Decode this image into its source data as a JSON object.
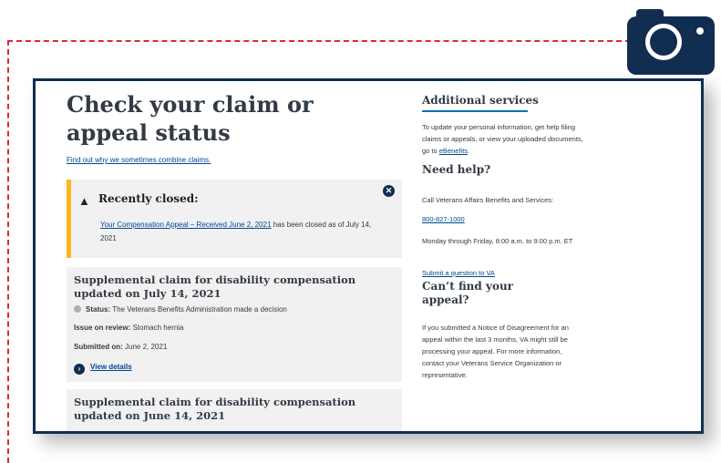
{
  "main": {
    "title": "Check your claim or appeal status",
    "combine_link": "Find out why we sometimes combine claims."
  },
  "alert": {
    "title": "Recently closed:",
    "link_text": "Your Compensation Appeal – Received June 2, 2021",
    "text": " has been closed as of July 14, 2021"
  },
  "claims": [
    {
      "title": "Supplemental claim for disability compensation updated on July 14, 2021",
      "status_label": "Status:",
      "status_text": " The Veterans Benefits Administration made a decision",
      "issue_label": "Issue on review:",
      "issue_value": " Stomach hernia",
      "submitted_label": "Submitted on:",
      "submitted_value": " June 2, 2021",
      "details_link": "View details"
    },
    {
      "title": "Supplemental claim for disability compensation updated on June 14, 2021"
    }
  ],
  "sidebar": {
    "additional_heading": "Additional services",
    "additional_text": "To update your personal information, get help filing claims or appeals, or view your uploaded documents, go to ",
    "ebenefits_link": "eBenefits",
    "period": ".",
    "help_heading": "Need help?",
    "help_call": "Call Veterans Affairs Benefits and Services:",
    "phone": "800-827-1000",
    "hours": "Monday through Friday, 8:00 a.m. to 9:00 p.m. ET",
    "submit_link": "Submit a question to VA",
    "cant_find_heading": "Can’t find your appeal?",
    "cant_find_text": "If you submitted a Notice of Disagreement for an appeal within the last 3 months, VA might still be processing your appeal. For more information, contact your Veterans Service Organization or representative."
  },
  "colors": {
    "navy": "#112e51",
    "link": "#004795",
    "alert_border": "#fdb81e",
    "dashed_frame": "#d9293e",
    "card_bg": "#f1f1f1"
  },
  "icons": [
    "camera-icon",
    "warning-icon",
    "close-icon",
    "arrow-right-circle-icon",
    "status-dot-icon"
  ]
}
